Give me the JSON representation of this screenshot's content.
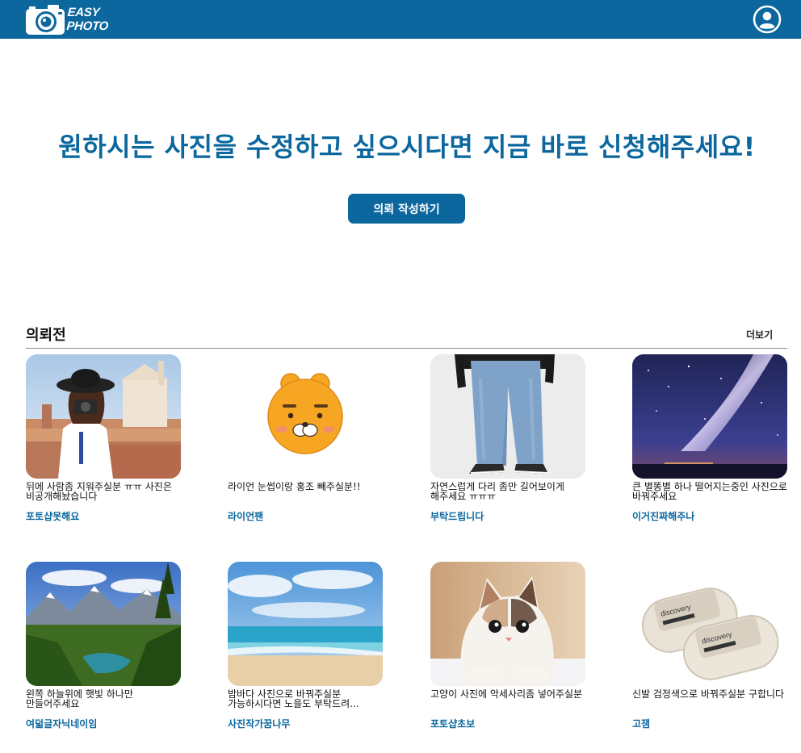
{
  "header": {
    "logo_line1": "EASY",
    "logo_line2": "PHOTO",
    "logo_icon": "camera-icon",
    "user_icon": "user-circle-icon",
    "bar_color": "#0b679e"
  },
  "hero": {
    "title": "원하시는 사진을 수정하고 싶으시다면 지금 바로 신청해주세요!",
    "cta_label": "의뢰 작성하기"
  },
  "section": {
    "title": "의뢰전",
    "more_label": "더보기"
  },
  "cards": [
    {
      "image": "woman-with-camera-photo",
      "description": "뒤에 사람좀 지워주실분 ㅠㅠ 사진은 비공개해놨습니다",
      "author": "포토샵못해요"
    },
    {
      "image": "ryan-character-photo",
      "description": "라이언 눈썹이랑 홍조 빼주실분!!",
      "author": "라이언팬"
    },
    {
      "image": "jeans-photo",
      "description": "자연스럽게 다리 좀만 길어보이게 해주세요 ㅠㅠㅠ",
      "author": "부탁드립니다"
    },
    {
      "image": "milky-way-photo",
      "description": "큰 별똥별 하나 떨어지는중인 사진으로 바꿔주세요",
      "author": "이거진짜해주나"
    },
    {
      "image": "mountain-lake-photo",
      "description": "왼쪽 하늘위에 햇빛 하나만 만들어주세요",
      "author": "여덟글자닉네이임"
    },
    {
      "image": "beach-photo",
      "description": "밤바다 사진으로 바꿔주실분 가능하시다면 노을도 부탁드려...",
      "author": "사진작가꿈나무"
    },
    {
      "image": "cat-photo",
      "description": "고양이 사진에 악세사리좀 넣어주실분",
      "author": "포토샵초보"
    },
    {
      "image": "slippers-photo",
      "description": "신발 검정색으로 바꿔주실분 구합니다",
      "author": "고잼"
    }
  ]
}
